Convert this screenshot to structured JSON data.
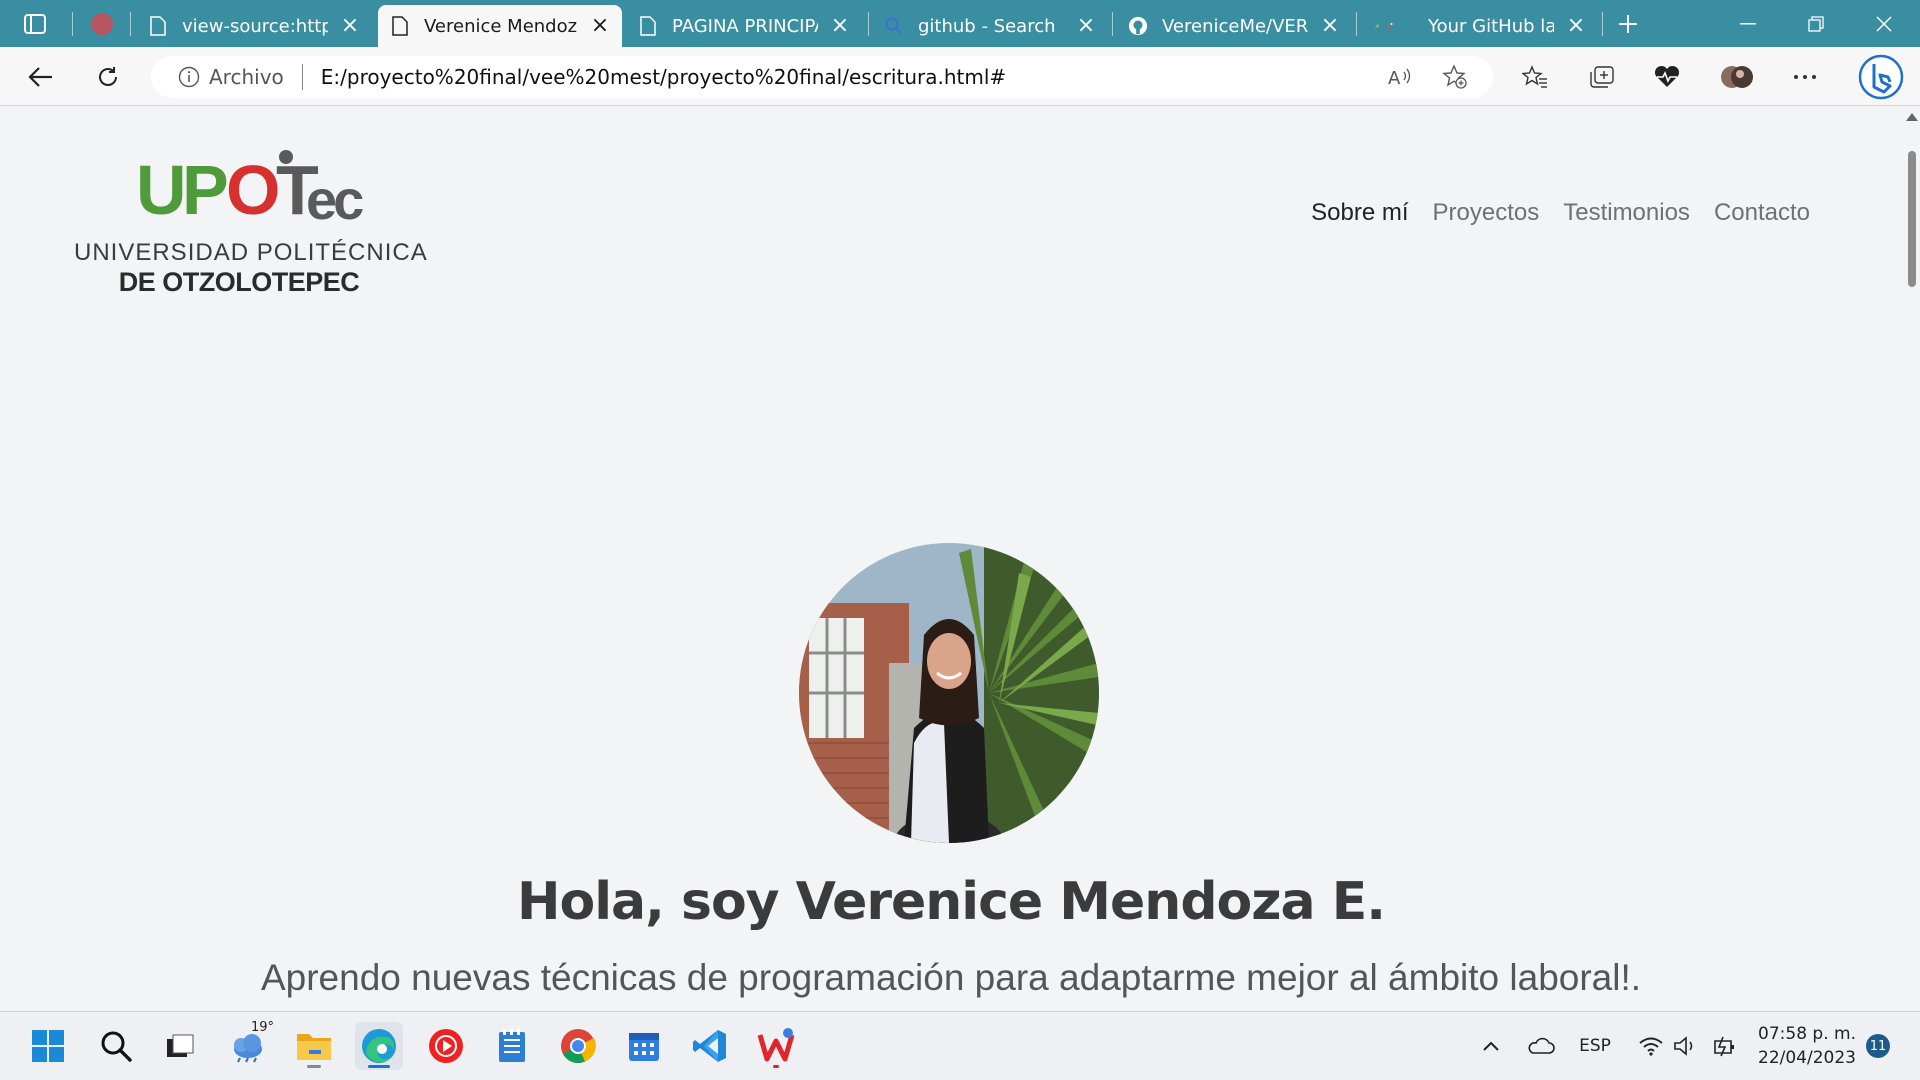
{
  "browser": {
    "tabs": [
      {
        "title": "view-source:https:/",
        "favicon": "document-icon"
      },
      {
        "title": "Verenice Mendoza",
        "favicon": "document-icon",
        "active": true
      },
      {
        "title": "PAGINA PRINCIPAL",
        "favicon": "document-icon"
      },
      {
        "title": "github - Search",
        "favicon": "search-icon"
      },
      {
        "title": "VereniceMe/VEREN",
        "favicon": "github-icon"
      },
      {
        "title": "Your GitHub la",
        "favicon": "rocket-icon"
      }
    ],
    "address": {
      "security_label": "Archivo",
      "url": "E:/proyecto%20final/vee%20mest/proyecto%20final/escritura.html#"
    }
  },
  "site": {
    "logo": {
      "wordmark": {
        "u": "U",
        "p": "P",
        "o": "O",
        "t": "T",
        "ec": "ec"
      },
      "line1": "UNIVERSIDAD POLITÉCNICA",
      "line2": "DE OTZOLOTEPEC"
    },
    "nav": [
      {
        "label": "Sobre mí"
      },
      {
        "label": "Proyectos"
      },
      {
        "label": "Testimonios"
      },
      {
        "label": "Contacto"
      }
    ],
    "hero": {
      "title": "Hola, soy Verenice Mendoza E.",
      "subtitle": "Aprendo nuevas técnicas de programación para adaptarme mejor al ámbito laboral!."
    }
  },
  "taskbar": {
    "weather_temp": "19°",
    "language": "ESP",
    "time": "07:58 p. m.",
    "date": "22/04/2023",
    "notifications": "11"
  },
  "colors": {
    "tabstrip": "#3a8ea1",
    "logo_green": "#4f9a3a",
    "logo_red": "#d6302f",
    "logo_gray": "#5a5a5a",
    "page_bg": "#f3f4f5"
  }
}
